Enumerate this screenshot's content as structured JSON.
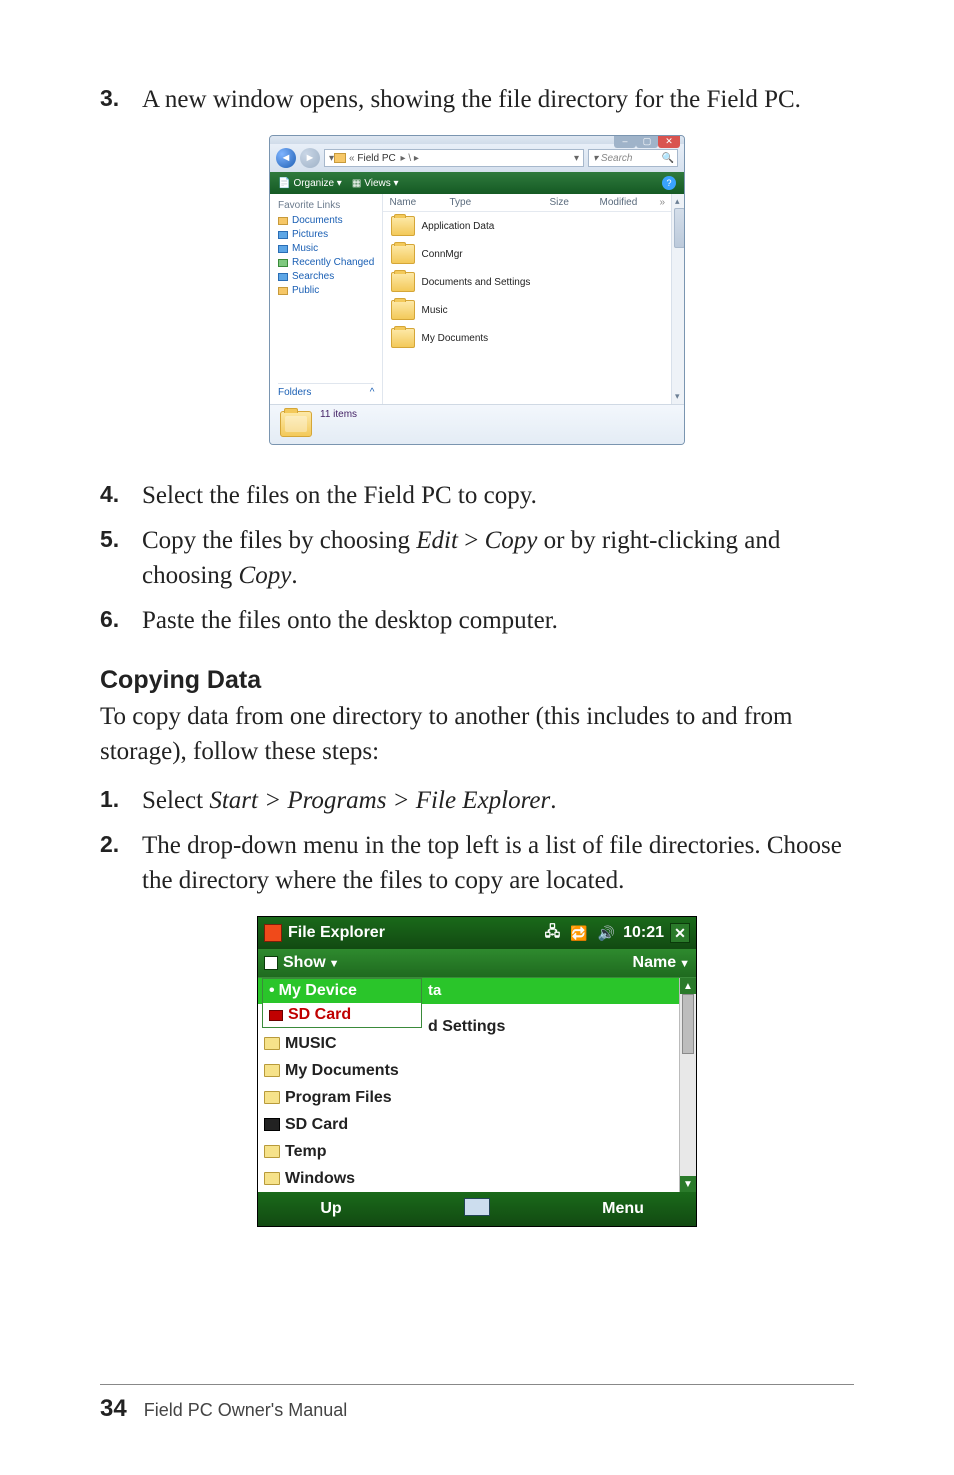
{
  "step3": {
    "num": "3.",
    "text_a": "A new window opens, showing the file directory for the Field PC."
  },
  "vista": {
    "addr_label": "Field PC",
    "addr_sep1": "▸ \\ ▸",
    "search_placeholder": "Search",
    "toolbar": {
      "organize": "Organize ▾",
      "views": "Views ▾"
    },
    "columns": {
      "name": "Name",
      "type": "Type",
      "size": "Size",
      "modified": "Modified",
      "more": "»"
    },
    "fav_header": "Favorite Links",
    "favs": [
      "Documents",
      "Pictures",
      "Music",
      "Recently Changed",
      "Searches",
      "Public"
    ],
    "folders_label": "Folders",
    "folders_chevron": "^",
    "items": [
      "Application Data",
      "ConnMgr",
      "Documents and Settings",
      "Music",
      "My Documents"
    ],
    "status": "11 items"
  },
  "step4": {
    "num": "4.",
    "text": "Select the files on the Field PC to copy."
  },
  "step5": {
    "num": "5.",
    "prefix": "Copy the files by choosing ",
    "cmd1": "Edit",
    "gt": " > ",
    "cmd2": "Copy",
    "mid": " or by right-clicking and choosing ",
    "cmd3": "Copy",
    "suffix": "."
  },
  "step6": {
    "num": "6.",
    "text": "Paste the files onto the desktop computer."
  },
  "heading": "Copying Data",
  "para": "To copy data from one directory to another (this includes to and from storage), follow these steps:",
  "cstep1": {
    "num": "1.",
    "prefix": "Select ",
    "path": "Start > Programs > File Explorer",
    "suffix": "."
  },
  "cstep2": {
    "num": "2.",
    "text": "The drop-down menu in the top left is a list of file directories. Choose the directory where the files to copy are located."
  },
  "mobile": {
    "title": "File Explorer",
    "time": "10:21",
    "show": "Show",
    "name": "Name",
    "drop_head": "My Device",
    "drop_sd": "SD Card",
    "frag_ta": "ta",
    "frag_settings": "d Settings",
    "rows": [
      "MUSIC",
      "My Documents",
      "Program Files",
      "SD Card",
      "Temp",
      "Windows"
    ],
    "bottom_left": "Up",
    "bottom_right": "Menu"
  },
  "footer": {
    "page": "34",
    "title": "Field PC Owner's Manual"
  }
}
